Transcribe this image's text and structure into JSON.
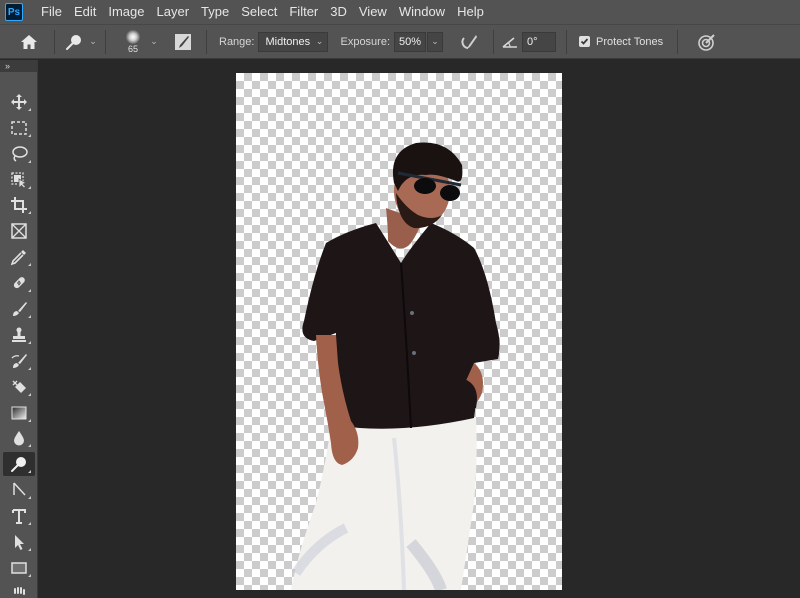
{
  "app": {
    "logo_text": "Ps",
    "accent_color": "#31a8ff"
  },
  "menubar": {
    "items": [
      "File",
      "Edit",
      "Image",
      "Layer",
      "Type",
      "Select",
      "Filter",
      "3D",
      "View",
      "Window",
      "Help"
    ]
  },
  "options": {
    "home_icon": "home-icon",
    "tool_preset_icon": "dodge-tool-icon",
    "brush_size": "65",
    "brush_settings_icon": "brush-settings-icon",
    "range_label": "Range:",
    "range_value": "Midtones",
    "exposure_label": "Exposure:",
    "exposure_value": "50%",
    "airbrush_icon": "airbrush-icon",
    "angle_icon": "angle-icon",
    "angle_value": "0°",
    "protect_tones_label": "Protect Tones",
    "protect_tones_checked": true,
    "pressure_icon": "pressure-size-icon"
  },
  "toolbar": {
    "collapse_label": "»",
    "tools": [
      {
        "name": "move-tool",
        "icon": "move-icon"
      },
      {
        "name": "marquee-tool",
        "icon": "rectangular-marquee-icon"
      },
      {
        "name": "lasso-tool",
        "icon": "lasso-icon"
      },
      {
        "name": "object-selection-tool",
        "icon": "object-selection-icon"
      },
      {
        "name": "crop-tool",
        "icon": "crop-icon"
      },
      {
        "name": "frame-tool",
        "icon": "frame-icon"
      },
      {
        "name": "eyedropper-tool",
        "icon": "eyedropper-icon"
      },
      {
        "name": "healing-brush-tool",
        "icon": "healing-brush-icon"
      },
      {
        "name": "brush-tool",
        "icon": "brush-icon"
      },
      {
        "name": "clone-stamp-tool",
        "icon": "clone-stamp-icon"
      },
      {
        "name": "history-brush-tool",
        "icon": "history-brush-icon"
      },
      {
        "name": "eraser-tool",
        "icon": "eraser-icon"
      },
      {
        "name": "gradient-tool",
        "icon": "gradient-icon"
      },
      {
        "name": "blur-tool",
        "icon": "blur-drop-icon"
      },
      {
        "name": "dodge-tool",
        "icon": "dodge-icon",
        "active": true
      },
      {
        "name": "pen-tool",
        "icon": "pen-icon"
      },
      {
        "name": "type-tool",
        "icon": "type-icon"
      },
      {
        "name": "path-selection-tool",
        "icon": "path-selection-icon"
      },
      {
        "name": "rectangle-tool",
        "icon": "rectangle-icon"
      },
      {
        "name": "hand-tool",
        "icon": "hand-icon"
      }
    ]
  },
  "document": {
    "content": "cutout photo of man in sunglasses, black shirt and white trousers on transparent background"
  }
}
